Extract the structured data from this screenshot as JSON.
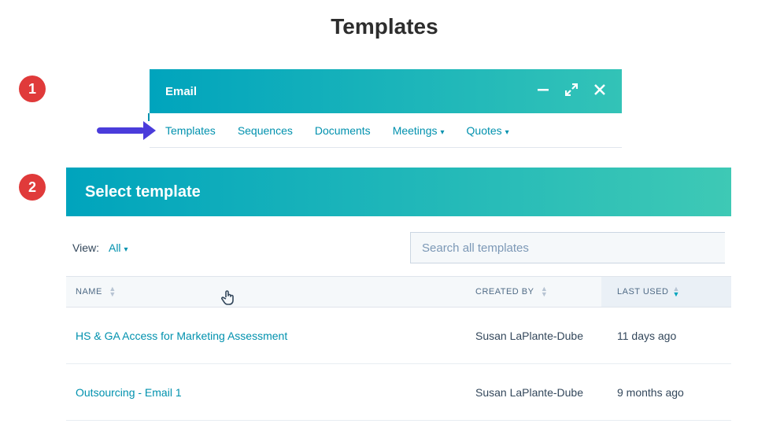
{
  "page": {
    "title": "Templates"
  },
  "steps": {
    "one": "1",
    "two": "2"
  },
  "email_window": {
    "title": "Email",
    "tabs": [
      "Templates",
      "Sequences",
      "Documents",
      "Meetings",
      "Quotes"
    ]
  },
  "panel": {
    "title": "Select template",
    "view_label": "View:",
    "view_value": "All",
    "search_placeholder": "Search all templates"
  },
  "table": {
    "headers": {
      "name": "NAME",
      "created_by": "CREATED BY",
      "last_used": "LAST USED"
    },
    "rows": [
      {
        "name": "HS & GA Access for Marketing Assessment",
        "created_by": "Susan LaPlante-Dube",
        "last_used": "11 days ago"
      },
      {
        "name": "Outsourcing - Email 1",
        "created_by": "Susan LaPlante-Dube",
        "last_used": "9 months ago"
      }
    ]
  }
}
